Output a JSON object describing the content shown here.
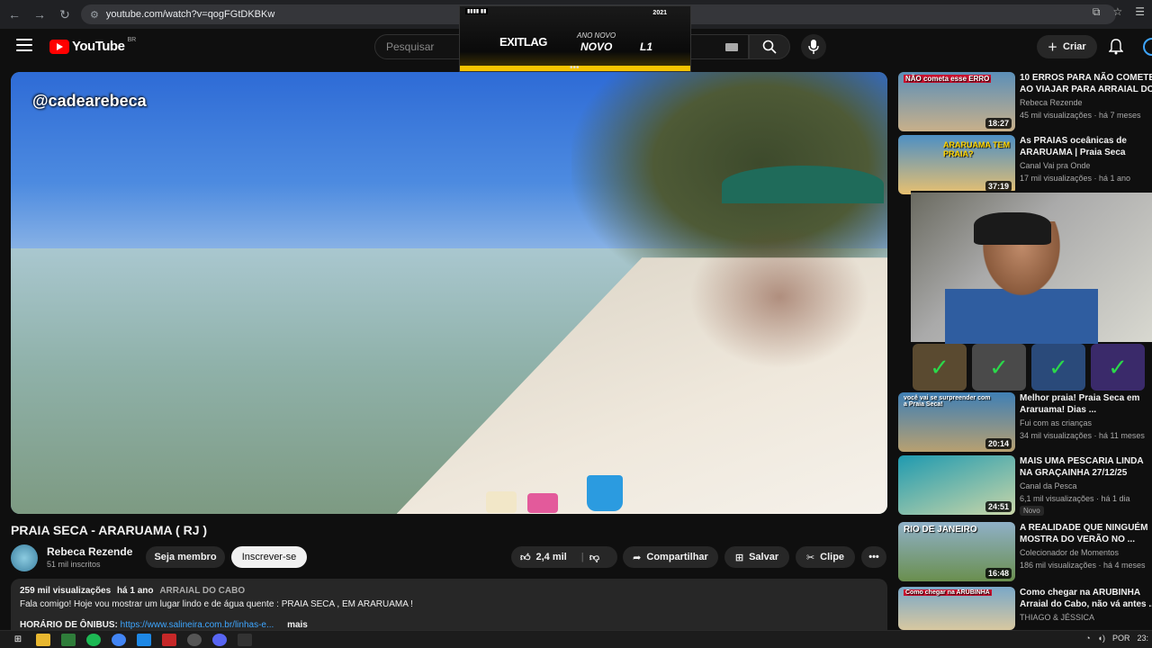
{
  "browser": {
    "url": "youtube.com/watch?v=qogFGtDKBKw",
    "back_icon": "back-arrow-icon",
    "forward_icon": "forward-arrow-icon",
    "reload_icon": "reload-icon"
  },
  "header": {
    "logo_text": "YouTube",
    "country_code": "BR",
    "search_placeholder": "Pesquisar",
    "create_label": "Criar"
  },
  "ad": {
    "badge": "▮▮▮▮ ▮▮",
    "brand": "EXITLAG",
    "subtitle": "ANO NOVO",
    "headline": "NOVO",
    "tail": "L1",
    "top_right": "2021"
  },
  "video": {
    "watermark": "@cadearebeca",
    "title": "PRAIA SECA - ARARUAMA ( RJ )",
    "channel_name": "Rebeca Rezende",
    "subscribers": "51 mil inscritos",
    "member_label": "Seja membro",
    "subscribe_label": "Inscrever-se",
    "likes": "2,4 mil",
    "share_label": "Compartilhar",
    "save_label": "Salvar",
    "clip_label": "Clipe",
    "views": "259 mil visualizações",
    "age": "há 1 ano",
    "location_tag": "ARRAIAL DO CABO",
    "description": "Fala comigo! Hoje vou mostrar um lugar lindo e de água quente : PRAIA SECA , EM ARARUAMA !",
    "desc_line3_label": "HORÁRIO DE ÔNIBUS: ",
    "desc_line3_link": "https://www.salineira.com.br/linhas-e...",
    "more_label": "mais"
  },
  "recommendations": [
    {
      "title": "10 ERROS PARA NÃO COMETER",
      "title2": "AO VIAJAR PARA ARRAIAL DO...",
      "channel": "Rebeca Rezende",
      "views": "45 mil visualizações · há 7 meses",
      "duration": "18:27",
      "thumb_label": "NÃO cometa esse ERRO",
      "thumb_color": "#5b8fb8"
    },
    {
      "title": "As PRAIAS oceânicas de",
      "title2": "ARARUAMA | Praia Seca",
      "channel": "Canal Vai pra Onde",
      "views": "17 mil visualizações · há 1 ano",
      "duration": "37:19",
      "thumb_label": "ARARUAMA TEM PRAIA?",
      "thumb_color": "#4d8fc4"
    },
    {
      "title": "Melhor praia! Praia Seca em",
      "title2": "Araruama! Dias ...",
      "channel": "Fui com as crianças",
      "views": "34 mil visualizações · há 11 meses",
      "duration": "20:14",
      "thumb_label": "você vai se surpreender com a Praia Seca!",
      "thumb_color": "#3f7fb5"
    },
    {
      "title": "MAIS UMA PESCARIA LINDA",
      "title2": "NA GRAÇAINHA 27/12/25",
      "channel": "Canal da Pesca",
      "views": "6,1 mil visualizações · há 1 dia",
      "duration": "24:51",
      "thumb_label": "",
      "thumb_color": "#2c8fa8",
      "badge": "Novo"
    },
    {
      "title": "A REALIDADE QUE NINGUÉM",
      "title2": "MOSTRA DO VERÃO NO ...",
      "channel": "Colecionador de Momentos",
      "views": "186 mil visualizações · há 4 meses",
      "duration": "16:48",
      "thumb_label": "RIO DE JANEIRO",
      "thumb_color": "#6a8f4e"
    },
    {
      "title": "Como chegar na ARUBINHA",
      "title2": "Arraial do Cabo, não vá antes ...",
      "channel": "THIAGO & JÉSSICA",
      "views": "",
      "duration": "",
      "thumb_label": "Como chegar na ARUBINHA",
      "thumb_color": "#7aa8c8"
    }
  ],
  "taskbar": {
    "lang": "POR",
    "clock": "23:"
  }
}
